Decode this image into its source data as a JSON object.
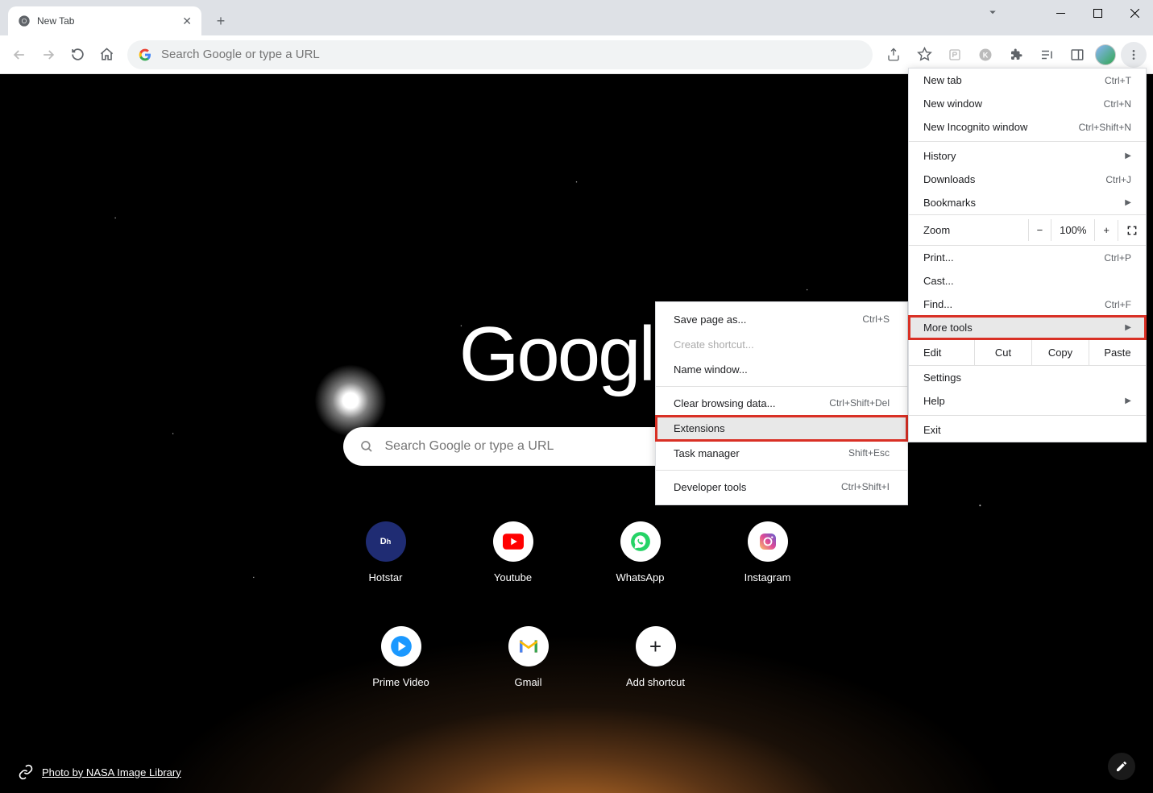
{
  "tab": {
    "title": "New Tab"
  },
  "omnibox": {
    "placeholder": "Search Google or type a URL"
  },
  "page": {
    "logo": "Google",
    "search_placeholder": "Search Google or type a URL",
    "photo_credit": "Photo by NASA Image Library"
  },
  "shortcuts_row1": [
    {
      "label": "Hotstar"
    },
    {
      "label": "Youtube"
    },
    {
      "label": "WhatsApp"
    },
    {
      "label": "Instagram"
    }
  ],
  "shortcuts_row2": [
    {
      "label": "Prime Video"
    },
    {
      "label": "Gmail"
    },
    {
      "label": "Add shortcut"
    }
  ],
  "menu": {
    "new_tab": "New tab",
    "new_tab_sc": "Ctrl+T",
    "new_window": "New window",
    "new_window_sc": "Ctrl+N",
    "incognito": "New Incognito window",
    "incognito_sc": "Ctrl+Shift+N",
    "history": "History",
    "downloads": "Downloads",
    "downloads_sc": "Ctrl+J",
    "bookmarks": "Bookmarks",
    "zoom": "Zoom",
    "zoom_value": "100%",
    "print": "Print...",
    "print_sc": "Ctrl+P",
    "cast": "Cast...",
    "find": "Find...",
    "find_sc": "Ctrl+F",
    "more_tools": "More tools",
    "edit": "Edit",
    "cut": "Cut",
    "copy": "Copy",
    "paste": "Paste",
    "settings": "Settings",
    "help": "Help",
    "exit": "Exit"
  },
  "submenu": {
    "save_page": "Save page as...",
    "save_page_sc": "Ctrl+S",
    "create_shortcut": "Create shortcut...",
    "name_window": "Name window...",
    "clear_data": "Clear browsing data...",
    "clear_data_sc": "Ctrl+Shift+Del",
    "extensions": "Extensions",
    "task_manager": "Task manager",
    "task_manager_sc": "Shift+Esc",
    "dev_tools": "Developer tools",
    "dev_tools_sc": "Ctrl+Shift+I"
  }
}
